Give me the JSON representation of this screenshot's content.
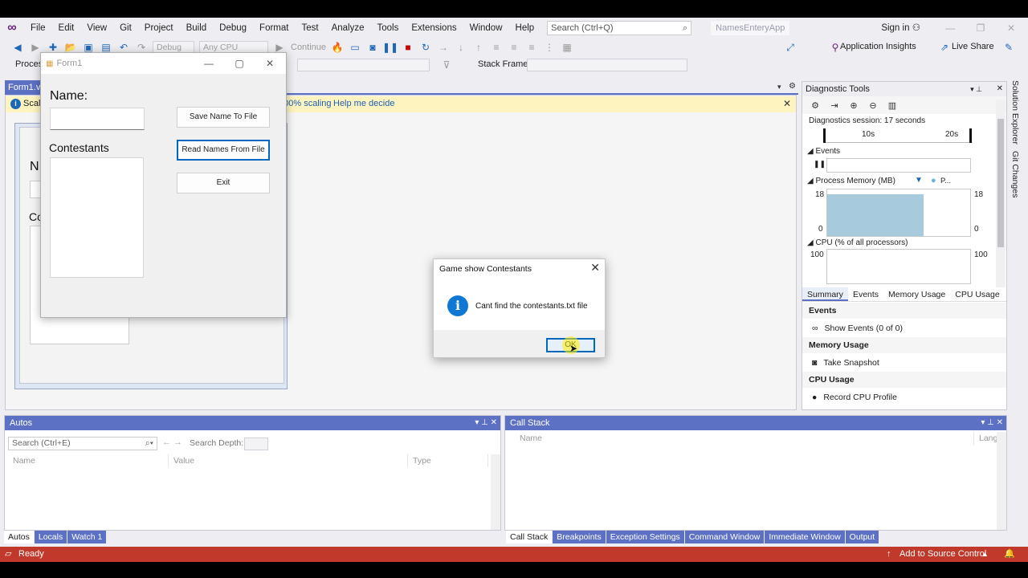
{
  "menu": {
    "items": [
      "File",
      "Edit",
      "View",
      "Git",
      "Project",
      "Build",
      "Debug",
      "Format",
      "Test",
      "Analyze",
      "Tools",
      "Extensions",
      "Window",
      "Help"
    ],
    "search_placeholder": "Search (Ctrl+Q)",
    "app_name": "NamesEnteryApp",
    "signin": "Sign in"
  },
  "toolbar": {
    "config": "Debug",
    "platform": "Any CPU",
    "continue_label": "Continue",
    "app_insights": "Application Insights",
    "live_share": "Live Share",
    "process_label": "Process:",
    "stack_frame_label": "Stack Frame:"
  },
  "editor": {
    "doc_tab": "Form1.vb",
    "infobar_prefix": "Scali",
    "infobar_scaling": "100% scaling",
    "infobar_help": "Help me decide"
  },
  "form1": {
    "title": "Form1",
    "name_label": "Name:",
    "contestants_label": "Contestants",
    "save_button": "Save Name To File",
    "read_button": "Read Names From File",
    "exit_button": "Exit"
  },
  "msgbox": {
    "title": "Game show Contestants",
    "message": "Cant find the contestants.txt file",
    "ok": "OK"
  },
  "diagnostics": {
    "title": "Diagnostic Tools",
    "session": "Diagnostics session: 17 seconds",
    "tick_10s": "10s",
    "tick_20s": "20s",
    "events_label": "Events",
    "memory_label": "Process Memory (MB)",
    "memory_legend": "P...",
    "memory_max": "18",
    "memory_min": "0",
    "cpu_label": "CPU (% of all processors)",
    "cpu_max": "100",
    "tabs": [
      "Summary",
      "Events",
      "Memory Usage",
      "CPU Usage"
    ],
    "sec_events": "Events",
    "show_events": "Show Events (0 of 0)",
    "sec_memory": "Memory Usage",
    "take_snapshot": "Take Snapshot",
    "sec_cpu": "CPU Usage",
    "record_cpu": "Record CPU Profile"
  },
  "side_tabs": [
    "Solution Explorer",
    "Git Changes"
  ],
  "autos": {
    "title": "Autos",
    "search_placeholder": "Search (Ctrl+E)",
    "search_depth": "Search Depth:",
    "columns": [
      "Name",
      "Value",
      "Type"
    ],
    "tabs": [
      "Autos",
      "Locals",
      "Watch 1"
    ]
  },
  "callstack": {
    "title": "Call Stack",
    "columns": [
      "Name",
      "Lang"
    ],
    "tabs": [
      "Call Stack",
      "Breakpoints",
      "Exception Settings",
      "Command Window",
      "Immediate Window",
      "Output"
    ]
  },
  "status": {
    "ready": "Ready",
    "source_control": "Add to Source Control"
  }
}
